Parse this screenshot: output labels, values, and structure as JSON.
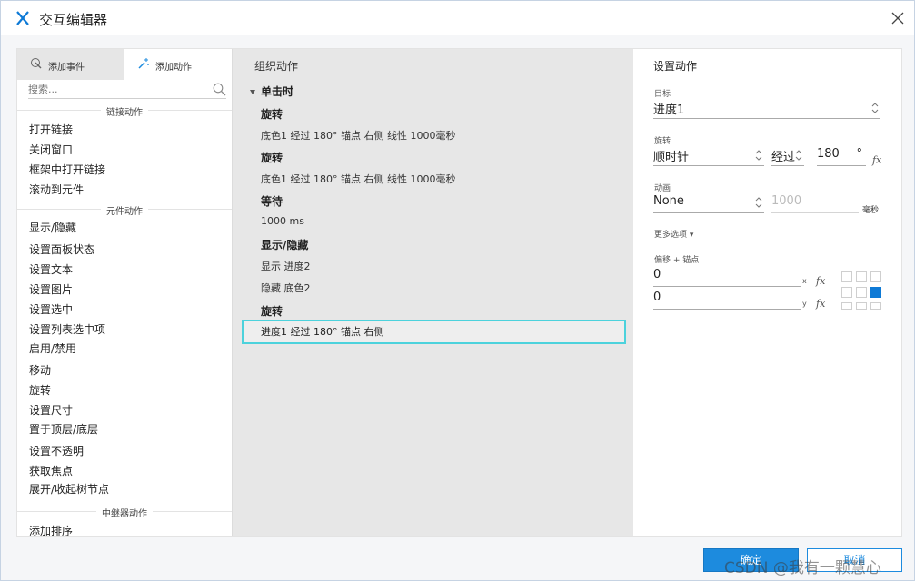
{
  "window": {
    "title": "交互编辑器"
  },
  "left_panel": {
    "tabs": [
      {
        "label": "添加事件"
      },
      {
        "label": "添加动作"
      }
    ],
    "search": {
      "placeholder": "搜索..."
    },
    "sections": [
      {
        "title": "链接动作",
        "items": [
          "打开链接",
          "关闭窗口",
          "框架中打开链接",
          "滚动到元件"
        ]
      },
      {
        "title": "元件动作",
        "items": [
          "显示/隐藏",
          "设置面板状态",
          "设置文本",
          "设置图片",
          "设置选中",
          "设置列表选中项",
          "启用/禁用",
          "移动",
          "旋转",
          "设置尺寸",
          "置于顶层/底层",
          "设置不透明",
          "获取焦点",
          "展开/收起树节点"
        ]
      },
      {
        "title": "中继器动作",
        "items": [
          "添加排序"
        ]
      }
    ]
  },
  "middle_panel": {
    "heading": "组织动作",
    "event": "单击时",
    "actions": [
      {
        "name": "旋转",
        "details": [
          "底色1 经过 180° 锚点 右侧 线性 1000毫秒"
        ]
      },
      {
        "name": "旋转",
        "details": [
          "底色1 经过 180° 锚点 右侧 线性 1000毫秒"
        ]
      },
      {
        "name": "等待",
        "details": [
          "1000 ms"
        ]
      },
      {
        "name": "显示/隐藏",
        "details": [
          "显示 进度2",
          "隐藏 底色2"
        ]
      },
      {
        "name": "旋转",
        "details": [
          "进度1 经过 180° 锚点 右侧"
        ]
      }
    ]
  },
  "right_panel": {
    "heading": "设置动作",
    "target": {
      "label": "目标",
      "value": "进度1"
    },
    "rotate": {
      "label": "旋转",
      "direction": "顺时针",
      "mode": "经过",
      "degrees": "180",
      "degree_unit": "°"
    },
    "animation": {
      "label": "动画",
      "value": "None",
      "duration": "1000",
      "unit": "毫秒"
    },
    "more_options": "更多选项 ▾",
    "offset": {
      "label": "偏移 + 锚点",
      "x_value": "0",
      "y_value": "0",
      "x_axis": "x",
      "y_axis": "y",
      "fx": "fx"
    },
    "anchor_grid": {
      "active_cell": "middle-right",
      "active_color": "#0e7ad6"
    }
  },
  "footer": {
    "ok_label": "确定",
    "cancel_label": "取消"
  },
  "watermark": "CSDN @我有一颗慧心",
  "colors": {
    "accent": "#1d8bde",
    "selection_border": "#4cd2dc",
    "middle_bg": "#e7e7e7"
  }
}
